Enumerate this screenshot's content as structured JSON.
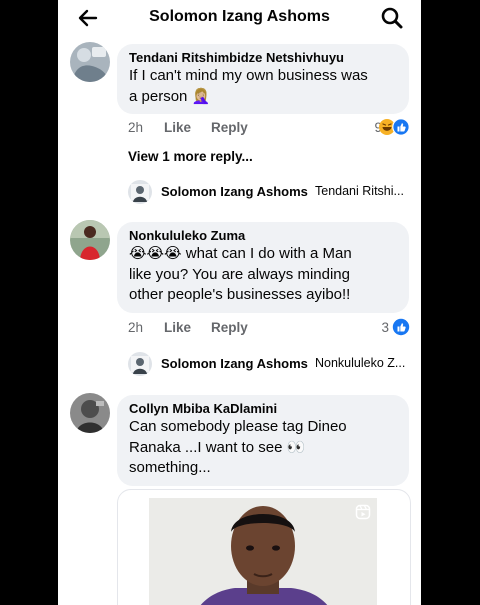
{
  "header": {
    "title": "Solomon Izang Ashoms",
    "back_icon": "arrow-left-icon",
    "search_icon": "search-icon"
  },
  "comments": [
    {
      "author": "Tendani Ritshimbidze Netshivhuyu",
      "text_line1": "If I can't mind my own business was",
      "text_line2": "a person",
      "emoji": "🤦🏼‍♀️",
      "time": "2h",
      "like": "Like",
      "reply": "Reply",
      "reaction_count": "9",
      "reactions": [
        "haha-icon",
        "like-icon"
      ],
      "view_more": "View 1 more reply...",
      "reply_author": "Solomon Izang Ashoms",
      "reply_target": "Tendani Ritshi..."
    },
    {
      "author": "Nonkululeko Zuma",
      "text_emojis": "😭😭😭",
      "text_line1": " what can I do with a Man",
      "text_line2": "like you? You are always minding",
      "text_line3": "other people's businesses ayibo!!",
      "time": "2h",
      "like": "Like",
      "reply": "Reply",
      "reaction_count": "3",
      "reactions": [
        "like-icon"
      ],
      "reply_author": "Solomon Izang Ashoms",
      "reply_target": "Nonkululeko Z..."
    },
    {
      "author": "Collyn Mbiba KaDlamini",
      "text_line1": "Can somebody please tag Dineo",
      "text_line2": "Ranaka ...I want to see",
      "text_emoji": "👀",
      "text_line3": "something..."
    }
  ],
  "colors": {
    "bubble": "#f0f2f5",
    "meta": "#65676b",
    "like_blue": "#1877f2",
    "haha_yellow": "#f7b125"
  }
}
